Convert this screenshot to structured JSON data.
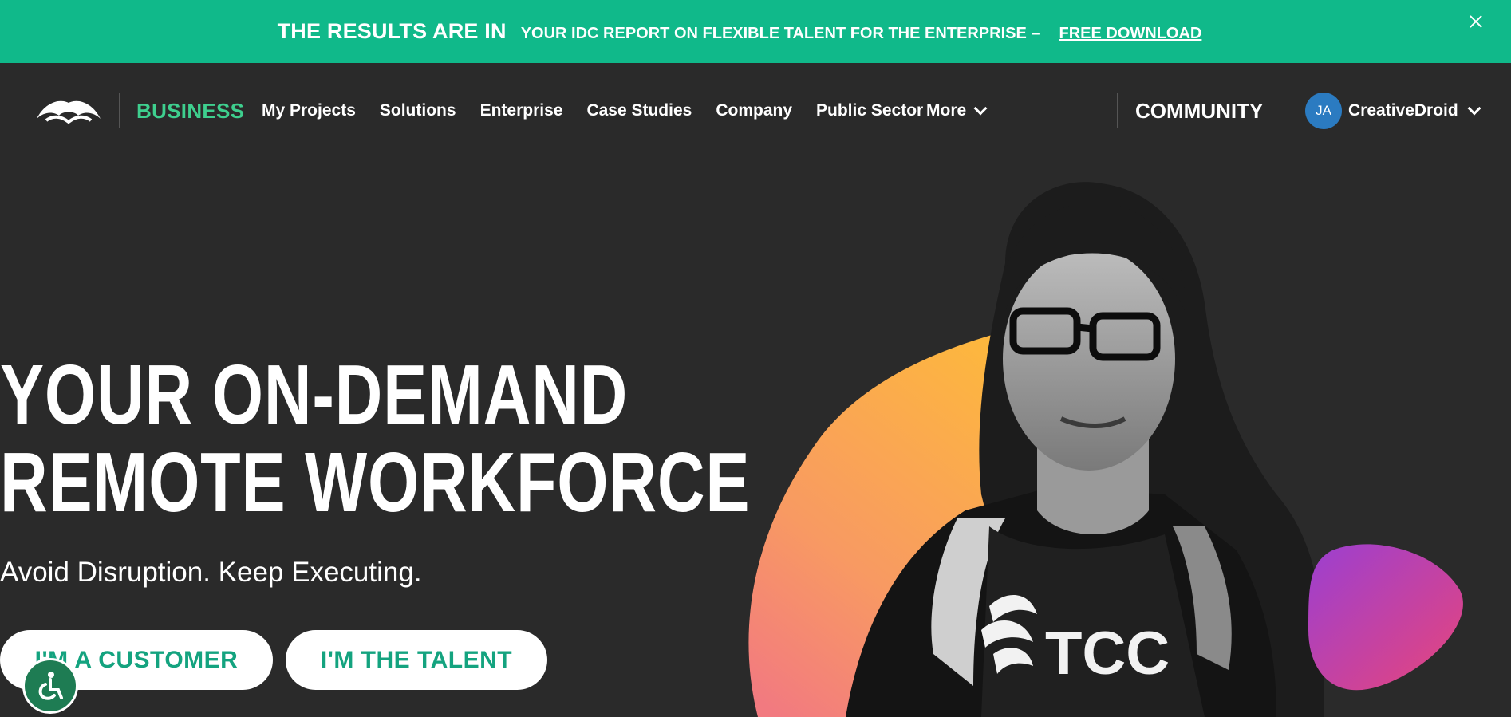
{
  "banner": {
    "title": "THE RESULTS ARE IN",
    "text": "YOUR IDC REPORT ON FLEXIBLE TALENT FOR THE ENTERPRISE –",
    "link": "FREE DOWNLOAD",
    "close_icon": "close-icon",
    "bg_color": "#10b98a"
  },
  "nav": {
    "brand": "BUSINESS",
    "links": [
      "My Projects",
      "Solutions",
      "Enterprise",
      "Case Studies",
      "Company",
      "Public Sector"
    ],
    "more": "More",
    "community": "COMMUNITY",
    "user": {
      "initials": "JA",
      "name": "CreativeDroid"
    },
    "accent_color": "#3ecf8e"
  },
  "hero": {
    "title_line1": "YOUR ON-DEMAND",
    "title_line2": "REMOTE WORKFORCE",
    "subtitle": "Avoid Disruption. Keep Executing.",
    "btn_customer": "I'M A CUSTOMER",
    "btn_talent": "I'M THE TALENT",
    "shirt_text": "TCC",
    "button_text_color": "#14a37f"
  },
  "accessibility": {
    "icon": "wheelchair-icon",
    "color": "#1e7c53"
  }
}
